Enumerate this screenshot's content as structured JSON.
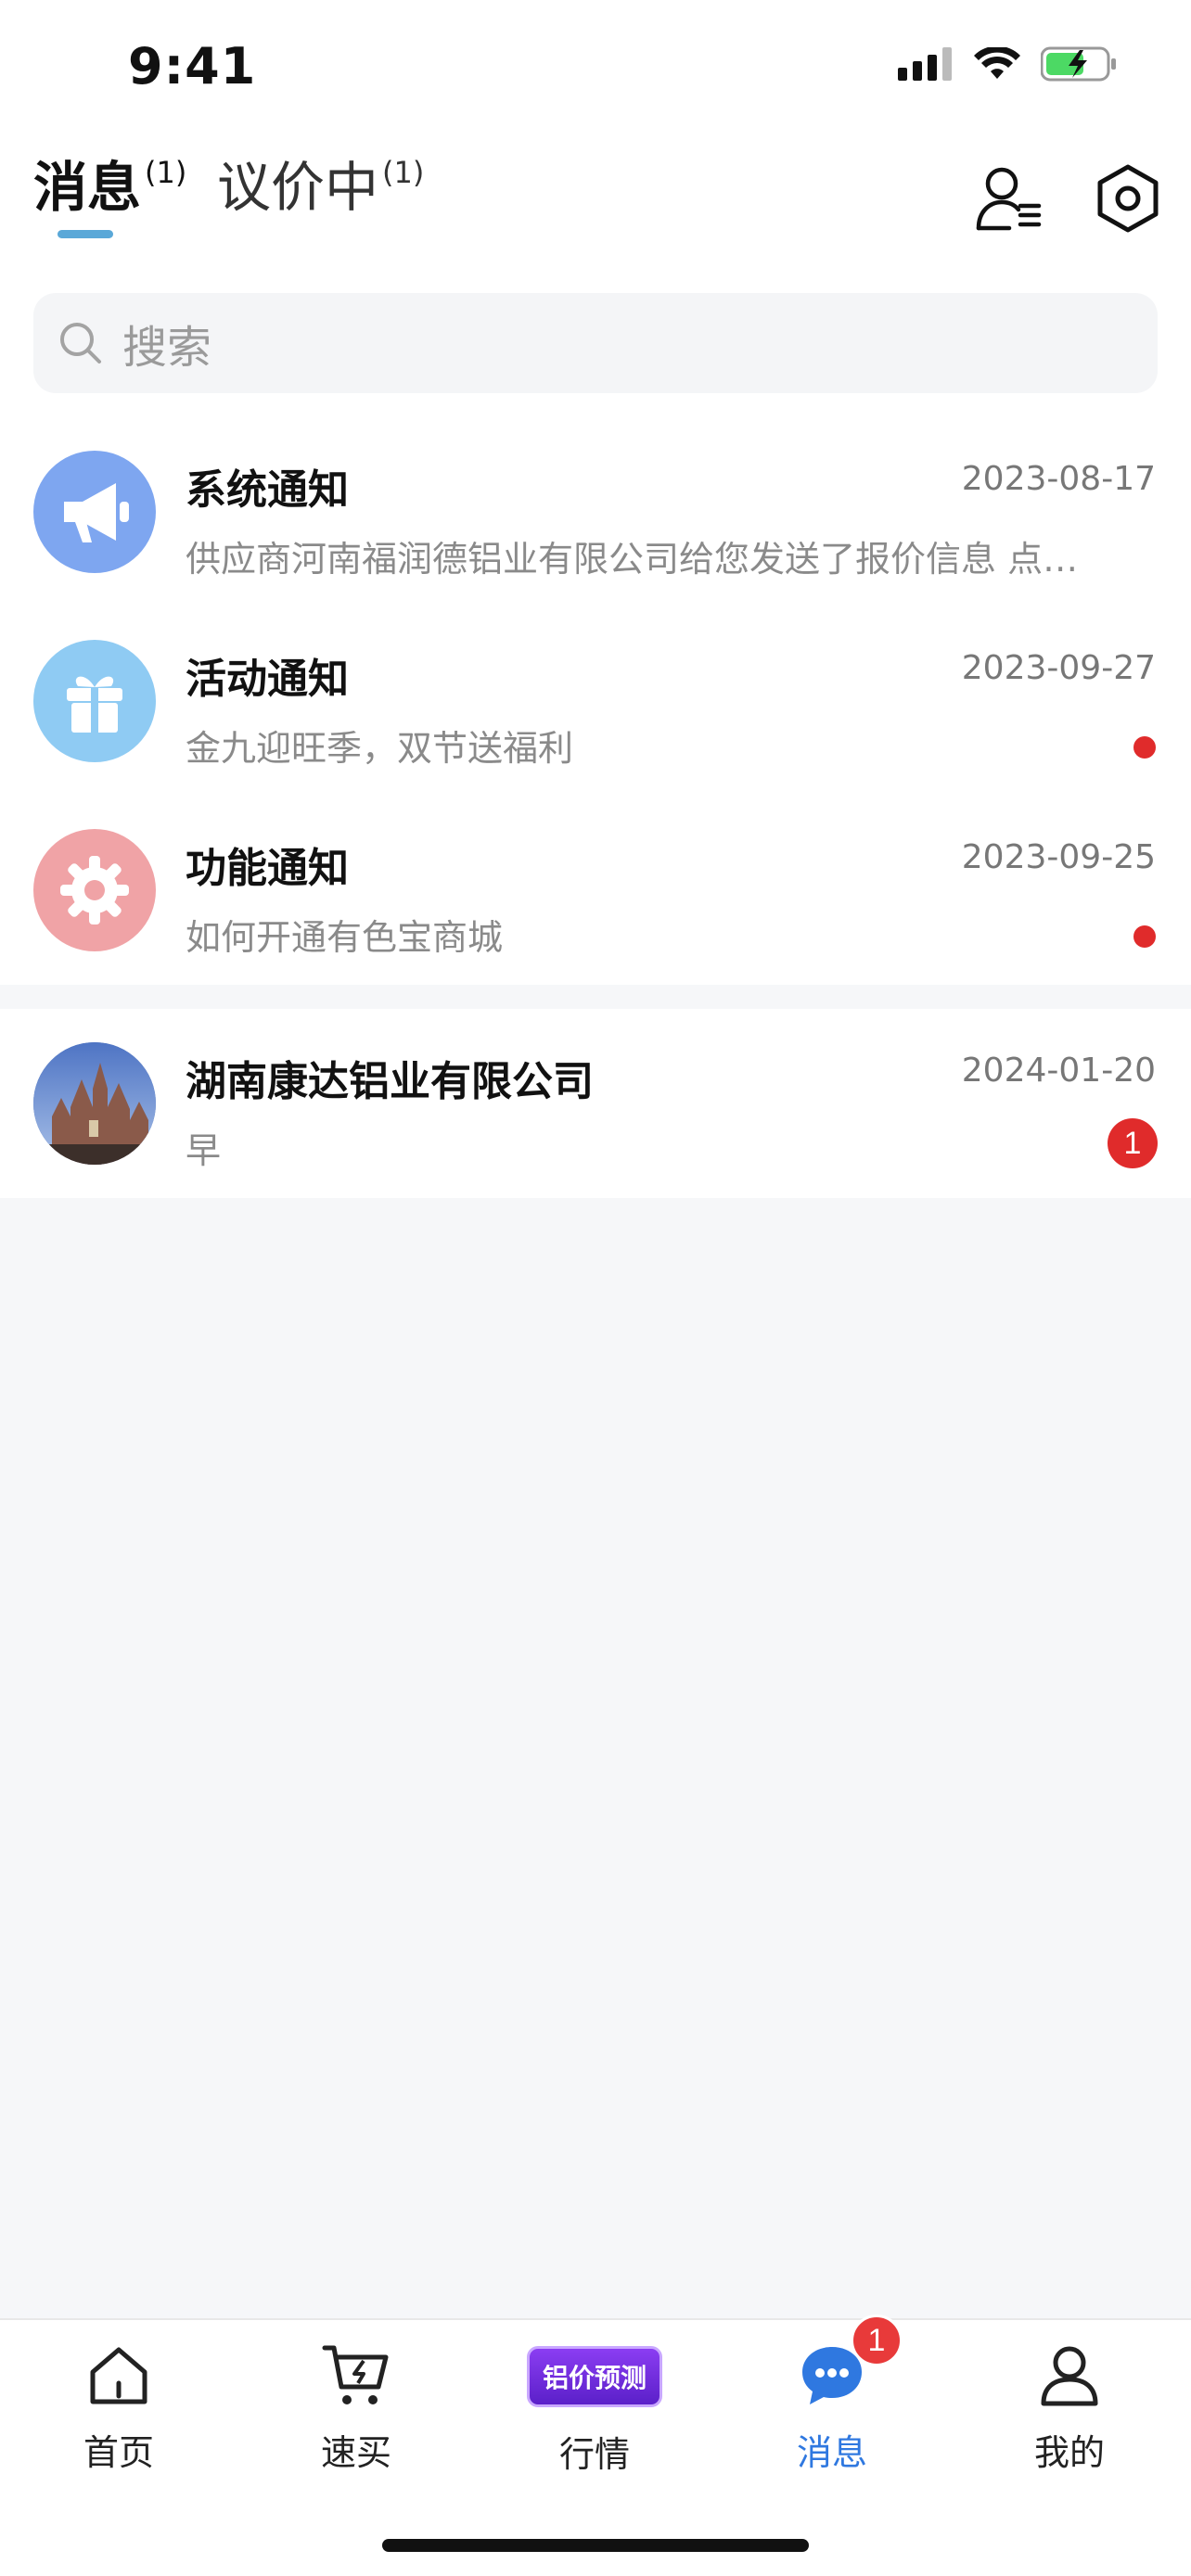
{
  "status": {
    "time": "9:41"
  },
  "header": {
    "tabs": [
      {
        "label": "消息",
        "count": "(1)"
      },
      {
        "label": "议价中",
        "count": "(1)"
      }
    ],
    "icons": [
      "contacts-icon",
      "settings-icon"
    ]
  },
  "search": {
    "placeholder": "搜索"
  },
  "messages": [
    {
      "title": "系统通知",
      "date": "2023-08-17",
      "preview": "供应商河南福润德铝业有限公司给您发送了报价信息 点…",
      "avatar": "megaphone-icon",
      "avatar_color": "#7ea6f0",
      "indicator": "none"
    },
    {
      "title": "活动通知",
      "date": "2023-09-27",
      "preview": "金九迎旺季，双节送福利",
      "avatar": "gift-icon",
      "avatar_color": "#8fcbf3",
      "indicator": "dot"
    },
    {
      "title": "功能通知",
      "date": "2023-09-25",
      "preview": "如何开通有色宝商城",
      "avatar": "gear-icon",
      "avatar_color": "#f0a3a6",
      "indicator": "dot"
    }
  ],
  "chats": [
    {
      "title": "湖南康达铝业有限公司",
      "date": "2024-01-20",
      "preview": "早",
      "avatar": "castle-photo",
      "unread": "1"
    }
  ],
  "tabbar": {
    "items": [
      {
        "label": "首页",
        "icon": "home-icon"
      },
      {
        "label": "速买",
        "icon": "cart-icon"
      },
      {
        "label": "行情",
        "icon": "promo-badge",
        "promo_text": "铝价预测"
      },
      {
        "label": "消息",
        "icon": "chat-icon",
        "badge": "1",
        "active": true
      },
      {
        "label": "我的",
        "icon": "profile-icon"
      }
    ]
  },
  "colors": {
    "accent": "#2f78e0",
    "tab_underline": "#5aa8d8",
    "badge": "#e02b2b"
  }
}
